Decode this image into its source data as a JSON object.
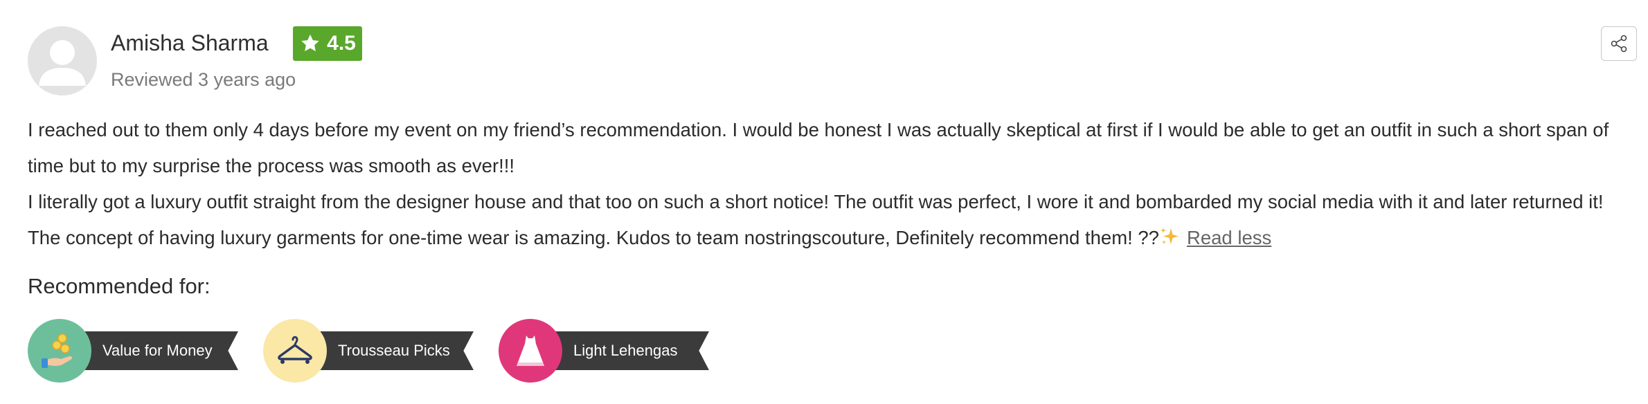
{
  "review": {
    "reviewer_name": "Amisha Sharma",
    "rating": "4.5",
    "reviewed_line": "Reviewed 3 years ago",
    "paragraphs": [
      "I reached out to them only 4 days before my event on my friend’s recommendation. I would be honest I was actually skeptical at first if I would be able to get an outfit in such a short span of",
      "time but to my surprise the process was smooth as ever!!!",
      "I literally got a luxury outfit straight from the designer house and that too on such a short notice! The outfit was perfect, I wore it and bombarded my social media with it and later returned it!",
      "The concept of having luxury garments for one-time wear is amazing. Kudos to team nostringscouture, Definitely recommend them! ??"
    ],
    "read_less_label": "Read less"
  },
  "recommended": {
    "heading": "Recommended for:",
    "badges": [
      {
        "label": "Value for Money",
        "icon": "coins-hand-icon",
        "color": "#6dbf9c"
      },
      {
        "label": "Trousseau Picks",
        "icon": "hanger-icon",
        "color": "#fbe7a6"
      },
      {
        "label": "Light Lehengas",
        "icon": "lehenga-icon",
        "color": "#e0377a"
      }
    ]
  },
  "colors": {
    "rating_badge": "#59a72b",
    "ribbon": "#3b3b3b",
    "avatar_bg": "#e3e3e3"
  }
}
